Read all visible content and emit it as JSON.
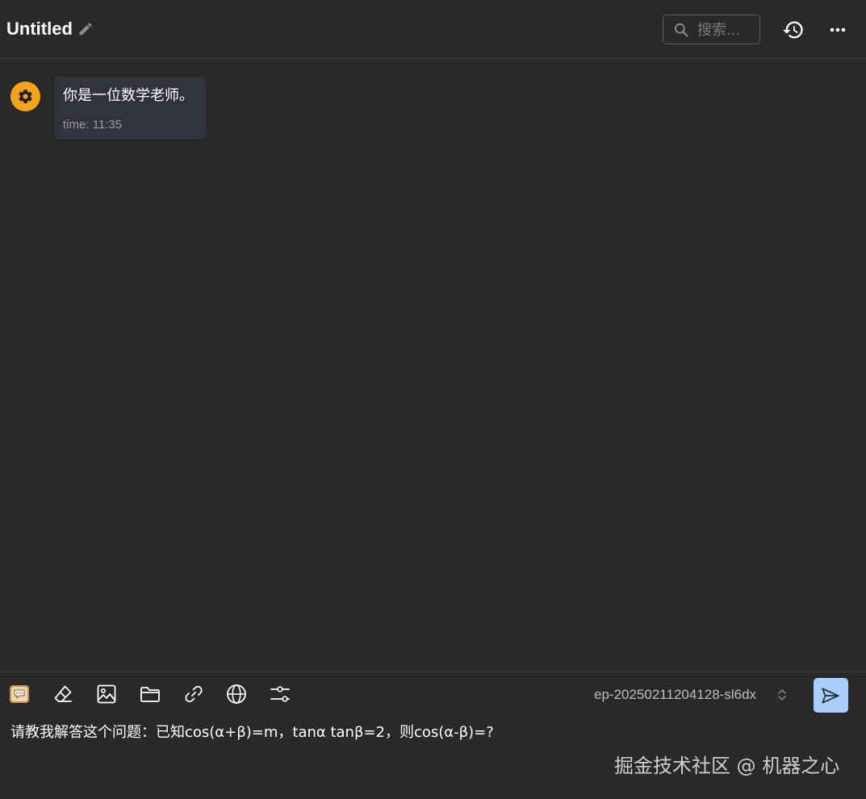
{
  "header": {
    "title": "Untitled",
    "search_placeholder": "搜索..."
  },
  "messages": [
    {
      "role": "system",
      "avatar_icon": "gear-icon",
      "text": "你是一位数学老师。",
      "time": "time: 11:35"
    }
  ],
  "composer": {
    "tools": [
      "chat-icon",
      "eraser-icon",
      "image-icon",
      "folder-icon",
      "link-icon",
      "globe-icon",
      "settings-sliders-icon"
    ],
    "model": "ep-20250211204128-sl6dx",
    "input_value": "请教我解答这个问题：已知cos(α+β)=m，tanα tanβ=2，则cos(α-β)=?",
    "send_icon": "send-icon"
  },
  "watermark": "掘金技术社区 @ 机器之心",
  "colors": {
    "background": "#292929",
    "avatar": "#f3a41c",
    "bubble": "#30333b",
    "send_button": "#a8cff8",
    "divider": "#3e3e3e"
  }
}
